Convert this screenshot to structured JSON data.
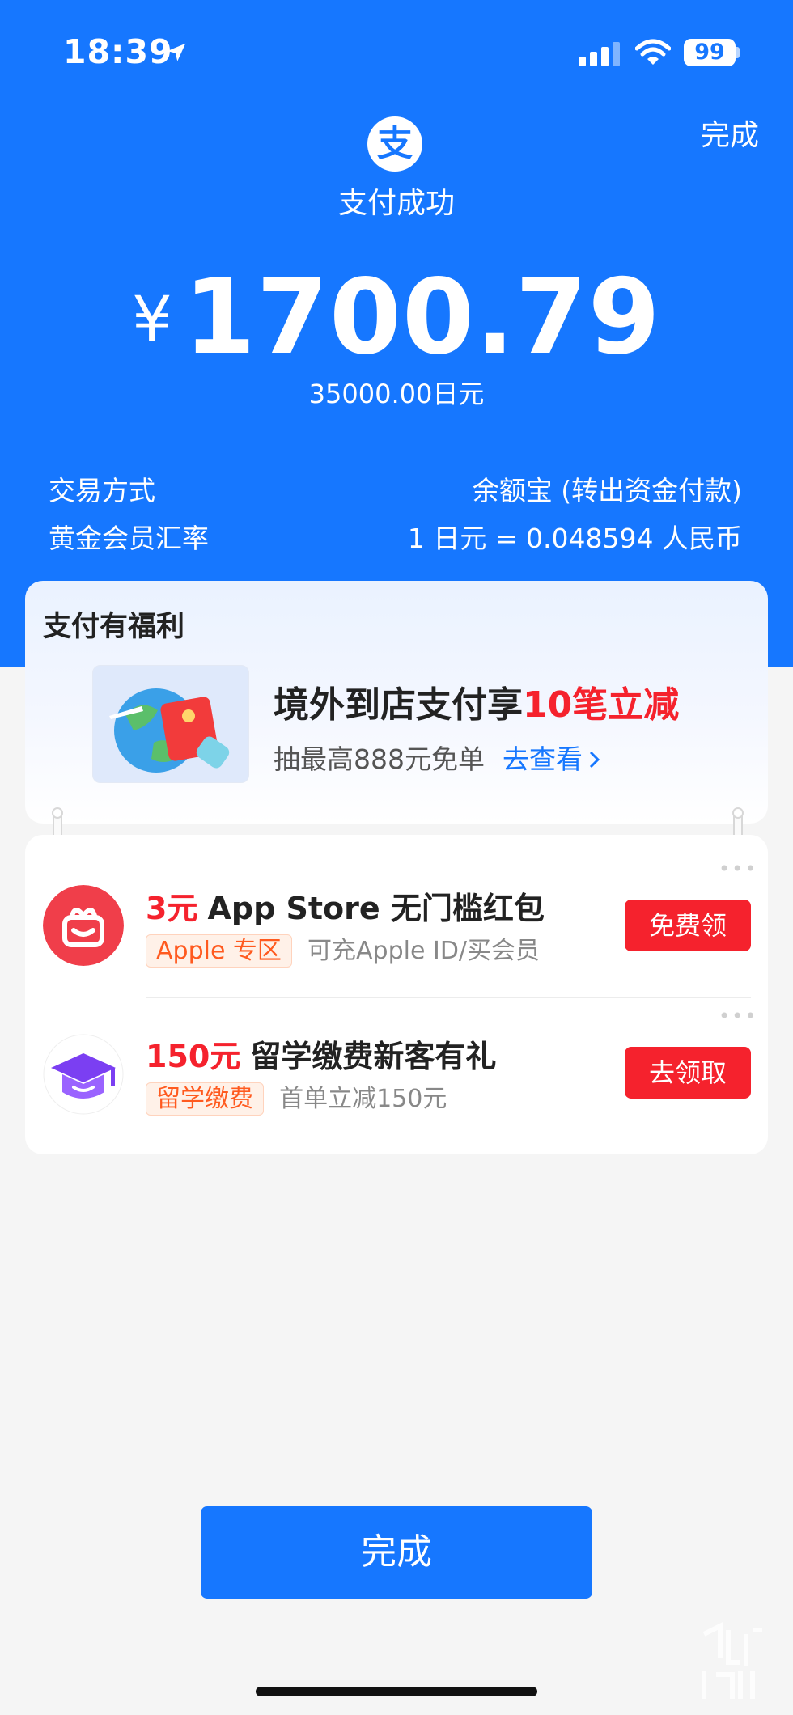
{
  "status_bar": {
    "time": "18:39",
    "battery": "99"
  },
  "header": {
    "done_label": "完成",
    "logo_char": "支",
    "title": "支付成功",
    "currency_symbol": "¥",
    "amount": "1700.79",
    "foreign_amount": "35000.00日元",
    "details": [
      {
        "label": "交易方式",
        "value": "余额宝 (转出资金付款)"
      },
      {
        "label": "黄金会员汇率",
        "value": "1 日元 = 0.048594 人民币"
      }
    ]
  },
  "benefits": {
    "title": "支付有福利",
    "headline_prefix": "境外到店支付享",
    "headline_highlight": "10笔立减",
    "subtitle": "抽最高888元免单",
    "link": "去查看"
  },
  "coupons": [
    {
      "amount": "3元",
      "title": "App Store 无门槛红包",
      "tag": "Apple 专区",
      "desc": "可充Apple ID/买会员",
      "button": "免费领",
      "icon": "gift-icon"
    },
    {
      "amount": "150元",
      "title": "留学缴费新客有礼",
      "tag": "留学缴费",
      "desc": "首单立减150元",
      "button": "去领取",
      "icon": "graduation-cap-icon"
    }
  ],
  "done_button": "完成",
  "colors": {
    "brand_blue": "#1677ff",
    "accent_red": "#f5222d",
    "tag_orange": "#ff5a1f"
  }
}
